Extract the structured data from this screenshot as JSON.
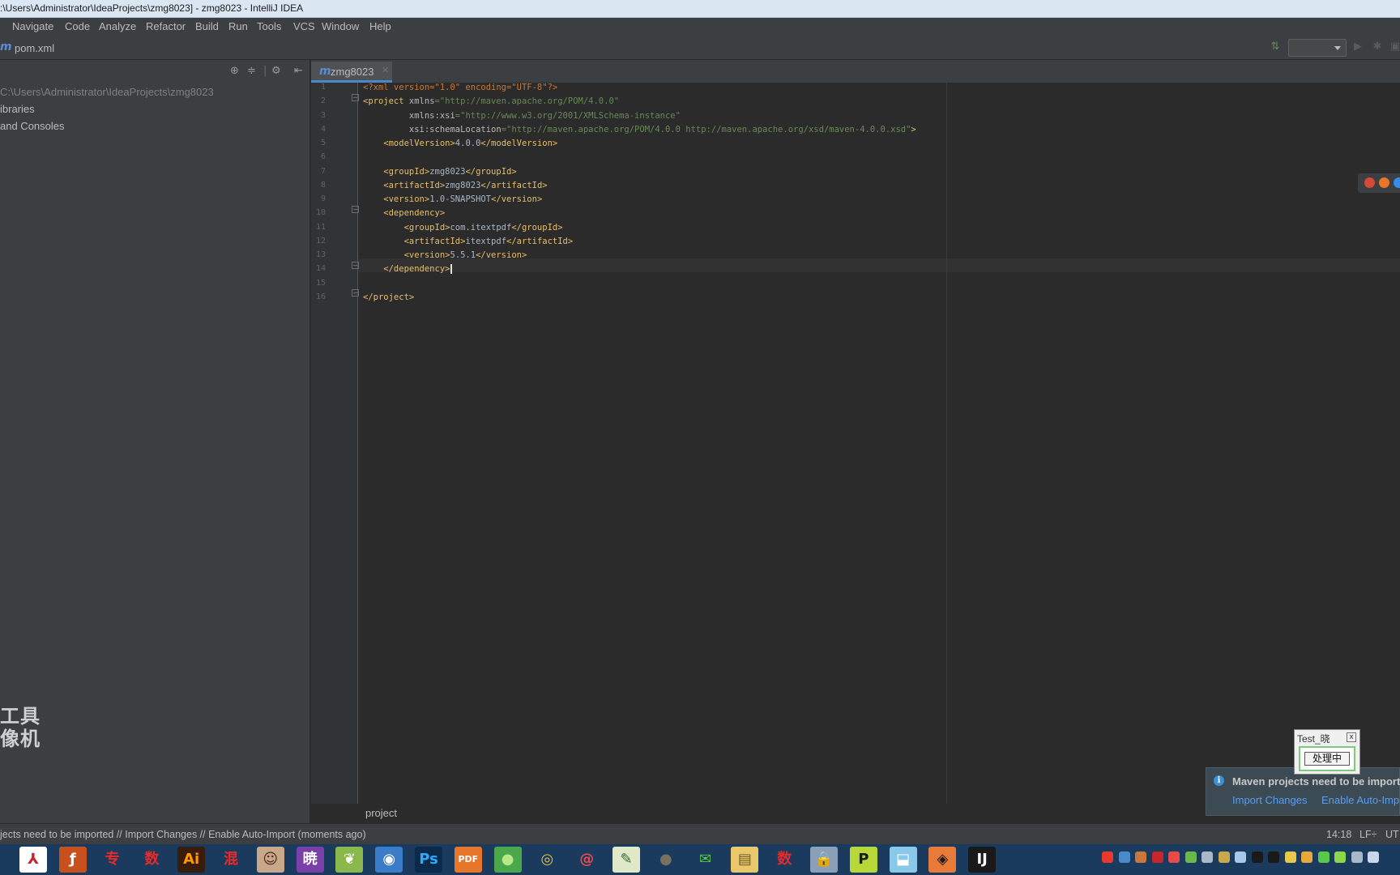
{
  "window": {
    "title": ":\\Users\\Administrator\\IdeaProjects\\zmg8023] - zmg8023 - IntelliJ IDEA"
  },
  "menu": [
    "Navigate",
    "Code",
    "Analyze",
    "Refactor",
    "Build",
    "Run",
    "Tools",
    "VCS",
    "Window",
    "Help"
  ],
  "navbar": {
    "file_icon": "m",
    "file_label": "pom.xml"
  },
  "project_panel": {
    "items": [
      "C:\\Users\\Administrator\\IdeaProjects\\zmg8023",
      "ibraries",
      "and Consoles"
    ],
    "watermark_line1": "工具",
    "watermark_line2": "像机"
  },
  "editor": {
    "tab_icon": "m",
    "tab_label": "zmg8023",
    "line_numbers": [
      "1",
      "2",
      "3",
      "4",
      "5",
      "6",
      "7",
      "8",
      "9",
      "10",
      "11",
      "12",
      "13",
      "14",
      "15",
      "16"
    ],
    "lines": [
      [
        {
          "t": "<?xml version=\"1.0\" encoding=\"UTF-8\"?>",
          "c": "c-pi"
        }
      ],
      [
        {
          "t": "<project ",
          "c": "c-tag"
        },
        {
          "t": "xmlns",
          "c": "c-attr"
        },
        {
          "t": "=\"http://maven.apache.org/POM/4.0.0\"",
          "c": "c-val"
        }
      ],
      [
        {
          "t": "         xmlns:xsi",
          "c": "c-attr"
        },
        {
          "t": "=\"http://www.w3.org/2001/XMLSchema-instance\"",
          "c": "c-val"
        }
      ],
      [
        {
          "t": "         xsi:schemaLocation",
          "c": "c-attr"
        },
        {
          "t": "=\"http://maven.apache.org/POM/4.0.0 http://maven.apache.org/xsd/maven-4.0.0.xsd\"",
          "c": "c-val"
        },
        {
          "t": ">",
          "c": "c-tag"
        }
      ],
      [
        {
          "t": "    <modelVersion>",
          "c": "c-tag"
        },
        {
          "t": "4.0.0",
          "c": "c-text"
        },
        {
          "t": "</modelVersion>",
          "c": "c-tag"
        }
      ],
      [
        {
          "t": "",
          "c": "c-text"
        }
      ],
      [
        {
          "t": "    <groupId>",
          "c": "c-tag"
        },
        {
          "t": "zmg8023",
          "c": "c-text"
        },
        {
          "t": "</groupId>",
          "c": "c-tag"
        }
      ],
      [
        {
          "t": "    <artifactId>",
          "c": "c-tag"
        },
        {
          "t": "zmg8023",
          "c": "c-text"
        },
        {
          "t": "</artifactId>",
          "c": "c-tag"
        }
      ],
      [
        {
          "t": "    <version>",
          "c": "c-tag"
        },
        {
          "t": "1.0-SNAPSHOT",
          "c": "c-text"
        },
        {
          "t": "</version>",
          "c": "c-tag"
        }
      ],
      [
        {
          "t": "    <dependency>",
          "c": "c-tag"
        }
      ],
      [
        {
          "t": "        <groupId>",
          "c": "c-tag"
        },
        {
          "t": "com.itextpdf",
          "c": "c-text"
        },
        {
          "t": "</groupId>",
          "c": "c-tag"
        }
      ],
      [
        {
          "t": "        <artifactId>",
          "c": "c-tag"
        },
        {
          "t": "itextpdf",
          "c": "c-text"
        },
        {
          "t": "</artifactId>",
          "c": "c-tag"
        }
      ],
      [
        {
          "t": "        <version>",
          "c": "c-tag"
        },
        {
          "t": "5.5.1",
          "c": "c-text"
        },
        {
          "t": "</version>",
          "c": "c-tag"
        }
      ],
      [
        {
          "t": "    </dependency>",
          "c": "c-tag"
        }
      ],
      [
        {
          "t": "",
          "c": "c-text"
        }
      ],
      [
        {
          "t": "</project>",
          "c": "c-tag"
        }
      ]
    ],
    "breadcrumb": "project"
  },
  "notification": {
    "title": "Maven projects need to be import",
    "link_import": "Import Changes",
    "link_auto": "Enable Auto-Imp"
  },
  "test_window": {
    "title": "Test_晓",
    "close": "x",
    "button": "处理中"
  },
  "statusbar": {
    "message": "jects need to be imported // Import Changes // Enable Auto-Import (moments ago)",
    "position": "14:18",
    "line_sep": "LF÷",
    "encoding": "UT"
  },
  "taskbar": {
    "icons": [
      {
        "name": "acrobat-icon",
        "label": "⅄",
        "color": "#ffffff",
        "fg": "#c0262b"
      },
      {
        "name": "flash-icon",
        "label": "ƒ",
        "color": "#c8501c",
        "fg": "#ffffff"
      },
      {
        "name": "zhuan-icon",
        "label": "专",
        "color": "#1a3a5e",
        "fg": "#e52b2b"
      },
      {
        "name": "shu-icon",
        "label": "数",
        "color": "#1a3a5e",
        "fg": "#e52b2b"
      },
      {
        "name": "illustrator-icon",
        "label": "Ai",
        "color": "#3a1c0a",
        "fg": "#ff9a00"
      },
      {
        "name": "hun-icon",
        "label": "混",
        "color": "#1a3a5e",
        "fg": "#e52b2b"
      },
      {
        "name": "photo-avatar-icon",
        "label": "☺",
        "color": "#c8a888",
        "fg": "#4a2a1a"
      },
      {
        "name": "xiao-icon",
        "label": "暁",
        "color": "#7b3fa8",
        "fg": "#ffffff"
      },
      {
        "name": "leaf-app-icon",
        "label": "❦",
        "color": "#8ab84a",
        "fg": "#ffffff"
      },
      {
        "name": "globe-icon",
        "label": "◉",
        "color": "#3a7cc8",
        "fg": "#ffffff"
      },
      {
        "name": "photoshop-icon",
        "label": "Ps",
        "color": "#0c2a4a",
        "fg": "#31a8ff"
      },
      {
        "name": "pdf-tool-icon",
        "label": "PDF",
        "color": "#e8762a",
        "fg": "#ffffff"
      },
      {
        "name": "green-ball-icon",
        "label": "●",
        "color": "#4aa84a",
        "fg": "#b8e88a"
      },
      {
        "name": "chrome-icon",
        "label": "◎",
        "color": "#1a3a5e",
        "fg": "#e8c43a"
      },
      {
        "name": "spiral-app-icon",
        "label": "@",
        "color": "#1a3a5e",
        "fg": "#e84a4a"
      },
      {
        "name": "notepad-icon",
        "label": "✎",
        "color": "#dfe8c8",
        "fg": "#3a6a2a"
      },
      {
        "name": "media-ball-icon",
        "label": "●",
        "color": "#1a3a5e",
        "fg": "#7a7060"
      },
      {
        "name": "wechat-icon",
        "label": "✉",
        "color": "#1a3a5e",
        "fg": "#5ac84a"
      },
      {
        "name": "folder-icon",
        "label": "▤",
        "color": "#e8c86a",
        "fg": "#6a5a2a"
      },
      {
        "name": "shu2-icon",
        "label": "数",
        "color": "#1a3a5e",
        "fg": "#e52b2b"
      },
      {
        "name": "lock-app-icon",
        "label": "🔒",
        "color": "#8aa0b8",
        "fg": "#ffffff"
      },
      {
        "name": "pycharm-icon",
        "label": "P",
        "color": "#b8d83a",
        "fg": "#1a1a1a"
      },
      {
        "name": "tool-app-icon",
        "label": "⬓",
        "color": "#88c8e8",
        "fg": "#ffffff"
      },
      {
        "name": "bird-app-icon",
        "label": "◈",
        "color": "#e87a3a",
        "fg": "#1a1a1a"
      },
      {
        "name": "intellij-icon",
        "label": "IJ",
        "color": "#1a1a1a",
        "fg": "#ffffff"
      }
    ],
    "tray": [
      {
        "name": "sogou-icon",
        "color": "#e83a2a"
      },
      {
        "name": "tray-app-icon-1",
        "color": "#4a8ac8"
      },
      {
        "name": "tray-app-icon-2",
        "color": "#c8783a"
      },
      {
        "name": "tray-acrobat-icon",
        "color": "#c8262a"
      },
      {
        "name": "tray-app-icon-3",
        "color": "#e84a4a"
      },
      {
        "name": "tray-app-icon-4",
        "color": "#6ab84a"
      },
      {
        "name": "bell-icon",
        "color": "#a8b8c8"
      },
      {
        "name": "tray-app-icon-5",
        "color": "#c8a84a"
      },
      {
        "name": "network-icon",
        "color": "#a8c8e8"
      },
      {
        "name": "qq-icon-1",
        "color": "#1a1a1a"
      },
      {
        "name": "qq-icon-2",
        "color": "#1a1a1a"
      },
      {
        "name": "tray-app-icon-6",
        "color": "#e8c84a"
      },
      {
        "name": "tray-app-icon-7",
        "color": "#e8a83a"
      },
      {
        "name": "tray-app-icon-8",
        "color": "#5ac84a"
      },
      {
        "name": "tray-app-icon-9",
        "color": "#8ad84a"
      },
      {
        "name": "display-icon",
        "color": "#a8b8c8"
      },
      {
        "name": "volume-icon",
        "color": "#c8d8e8"
      }
    ]
  }
}
